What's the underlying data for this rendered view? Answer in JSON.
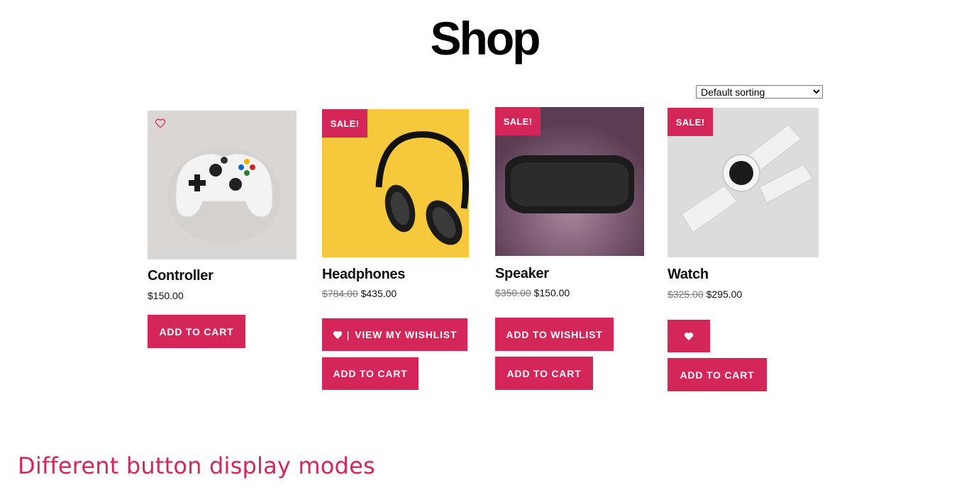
{
  "page": {
    "title": "Shop"
  },
  "sorting": {
    "selected": "Default sorting"
  },
  "products": [
    {
      "name": "Controller",
      "price": "$150.00",
      "on_sale": false,
      "buttons": {
        "cart": "ADD TO CART"
      }
    },
    {
      "name": "Headphones",
      "old_price": "$784.00",
      "price": "$435.00",
      "on_sale": true,
      "badge": "SALE!",
      "buttons": {
        "wishlist": "VIEW MY WISHLIST",
        "cart": "ADD TO CART"
      }
    },
    {
      "name": "Speaker",
      "old_price": "$350.00",
      "price": "$150.00",
      "on_sale": true,
      "badge": "SALE!",
      "buttons": {
        "wishlist": "ADD TO WISHLIST",
        "cart": "ADD TO CART"
      }
    },
    {
      "name": "Watch",
      "old_price": "$325.00",
      "price": "$295.00",
      "on_sale": true,
      "badge": "SALE!",
      "buttons": {
        "wishlist_icon": "heart-icon",
        "cart": "ADD TO CART"
      }
    }
  ],
  "caption": "Different button display modes",
  "colors": {
    "accent": "#d42659",
    "headphones_bg": "#f6c93c",
    "speaker_bg": "#6b4a63",
    "light_bg": "#d9d6d4"
  }
}
